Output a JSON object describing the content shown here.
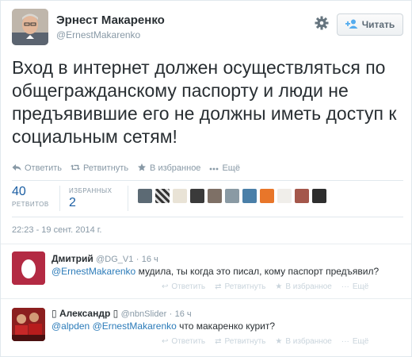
{
  "tweet": {
    "author_name": "Эрнест Макаренко",
    "author_handle": "@ErnestMakarenko",
    "follow_label": "Читать",
    "text": "Вход в интернет должен осуществляться по общегражданскому паспорту и люди не предъявившие его не должны иметь доступ к социальным сетям!",
    "actions": [
      {
        "label": "Ответить",
        "icon": "reply-icon"
      },
      {
        "label": "Ретвитнуть",
        "icon": "retweet-icon"
      },
      {
        "label": "В избранное",
        "icon": "star-icon"
      },
      {
        "label": "Ещё",
        "icon": "more-icon"
      }
    ],
    "retweets_count": "40",
    "retweets_label": "РЕТВИТОВ",
    "favorites_label": "ИЗБРАННЫХ",
    "favorites_count": "2",
    "timestamp": "22:23 - 19 сент. 2014 г."
  },
  "replies": [
    {
      "name": "Дмитрий",
      "handle": "@DG_V1",
      "age": "16 ч",
      "mention": "@ErnestMakarenko",
      "text": " мудила, ты когда это писал, кому паспорт предъявил?",
      "actions": [
        "Ответить",
        "Ретвитнуть",
        "В избранное",
        "Ещё"
      ]
    },
    {
      "name": "Александр",
      "handle": "@nbnSlider",
      "age": "16 ч",
      "mention1": "@alpden",
      "mention2": "@ErnestMakarenko",
      "text": " что макаренко курит?",
      "actions": [
        "Ответить",
        "Ретвитнуть",
        "В избранное",
        "Ещё"
      ]
    }
  ],
  "colors": {
    "link": "#2b7bb9",
    "muted": "#8899a6",
    "text": "#292f33",
    "stat": "#1b5ea3"
  }
}
